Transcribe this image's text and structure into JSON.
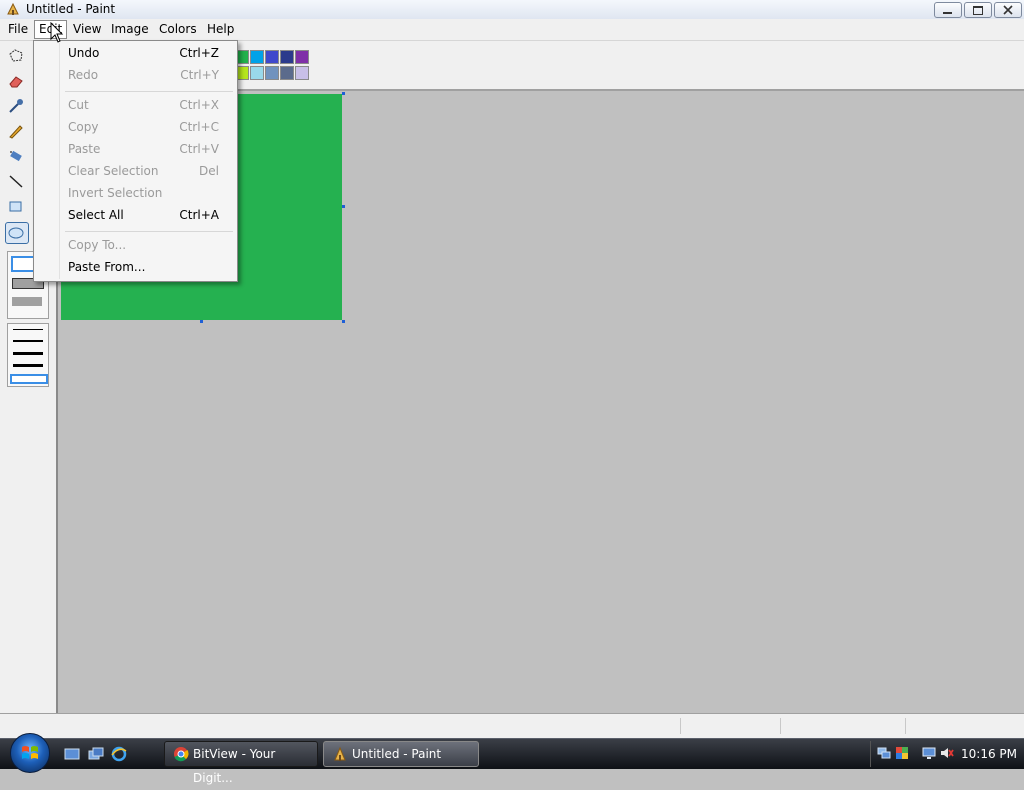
{
  "window": {
    "title": "Untitled - Paint",
    "controls": {
      "minimize": "minimize",
      "maximize": "maximize",
      "close": "close"
    }
  },
  "menubar": {
    "items": [
      {
        "label": "File"
      },
      {
        "label": "Edit",
        "state": "open"
      },
      {
        "label": "View"
      },
      {
        "label": "Image"
      },
      {
        "label": "Colors"
      },
      {
        "label": "Help"
      }
    ]
  },
  "edit_menu": {
    "items": [
      {
        "label": "Undo",
        "shortcut": "Ctrl+Z",
        "enabled": true
      },
      {
        "label": "Redo",
        "shortcut": "Ctrl+Y",
        "enabled": false
      },
      {
        "label": "Cut",
        "shortcut": "Ctrl+X",
        "enabled": false
      },
      {
        "label": "Copy",
        "shortcut": "Ctrl+C",
        "enabled": false
      },
      {
        "label": "Paste",
        "shortcut": "Ctrl+V",
        "enabled": false
      },
      {
        "label": "Clear Selection",
        "shortcut": "Del",
        "enabled": false
      },
      {
        "label": "Invert Selection",
        "shortcut": "",
        "enabled": false
      },
      {
        "label": "Select All",
        "shortcut": "Ctrl+A",
        "enabled": true
      },
      {
        "label": "Copy To...",
        "shortcut": "",
        "enabled": false
      },
      {
        "label": "Paste From...",
        "shortcut": "",
        "enabled": true
      }
    ]
  },
  "toolbox": {
    "tools": [
      "free-form-select-icon",
      "eraser-icon",
      "eyedropper-icon",
      "pencil-icon",
      "airbrush-icon",
      "line-icon",
      "rectangle-icon",
      "ellipse-icon"
    ],
    "selected_tool": "ellipse-icon"
  },
  "palette": {
    "visible_colors_row1": [
      "#22b14c",
      "#00a2e8",
      "#3f48cc",
      "#2b3a8c",
      "#7f2fa8"
    ],
    "visible_colors_row2": [
      "#b5e61d",
      "#99d9ea",
      "#7092be",
      "#5b6b8c",
      "#c8bfe7"
    ]
  },
  "canvas": {
    "fill_color": "#25b150"
  },
  "taskbar": {
    "buttons": [
      {
        "label": "BitView - Your Digit...",
        "icon": "chrome-icon"
      },
      {
        "label": "Untitled - Paint",
        "icon": "paint-icon",
        "active": true
      }
    ],
    "quick_launch": [
      "show-desktop-icon",
      "switch-windows-icon",
      "internet-explorer-icon"
    ],
    "tray_icons": [
      "network-icon",
      "security-icon",
      "display-icon",
      "volume-muted-icon"
    ],
    "clock": "10:16 PM"
  },
  "colors": {
    "menu_bg": "#f5f5f5",
    "window_bg": "#f0f0f0",
    "workspace": "#c0c0c0",
    "disabled_text": "#9a9a9a"
  }
}
